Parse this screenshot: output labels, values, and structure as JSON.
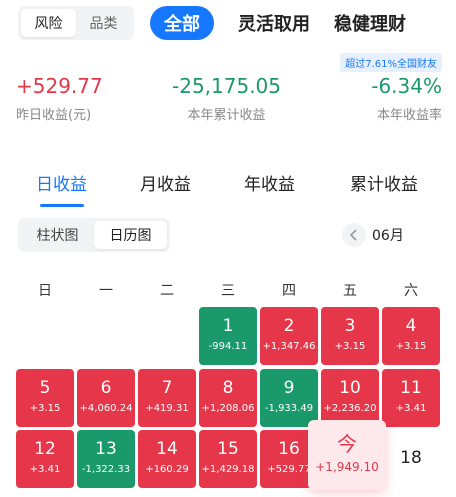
{
  "top_segment": {
    "items": [
      "风险",
      "品类"
    ],
    "active": 0
  },
  "top_nav": {
    "items": [
      "全部",
      "灵活取用",
      "稳健理财"
    ],
    "active": 0
  },
  "badge": "超过7.61%全国财友",
  "stats": [
    {
      "value": "+529.77",
      "label": "昨日收益(元)",
      "tone": "up"
    },
    {
      "value": "-25,175.05",
      "label": "本年累计收益",
      "tone": "down"
    },
    {
      "value": "-6.34%",
      "label": "本年收益率",
      "tone": "down"
    }
  ],
  "period_tabs": {
    "items": [
      "日收益",
      "月收益",
      "年收益",
      "累计收益"
    ],
    "active": 0
  },
  "view_toggle": {
    "items": [
      "柱状图",
      "日历图"
    ],
    "active": 1
  },
  "month": "06月",
  "weekdays": [
    "日",
    "一",
    "二",
    "三",
    "四",
    "五",
    "六"
  ],
  "calendar": {
    "days": [
      {
        "day": "1",
        "value": "-994.11",
        "tone": "down"
      },
      {
        "day": "2",
        "value": "+1,347.46",
        "tone": "up"
      },
      {
        "day": "3",
        "value": "+3.15",
        "tone": "up"
      },
      {
        "day": "4",
        "value": "+3.15",
        "tone": "up"
      },
      {
        "day": "5",
        "value": "+3.15",
        "tone": "up"
      },
      {
        "day": "6",
        "value": "+4,060.24",
        "tone": "up"
      },
      {
        "day": "7",
        "value": "+419.31",
        "tone": "up"
      },
      {
        "day": "8",
        "value": "+1,208.06",
        "tone": "up"
      },
      {
        "day": "9",
        "value": "-1,933.49",
        "tone": "down"
      },
      {
        "day": "10",
        "value": "+2,236.20",
        "tone": "up"
      },
      {
        "day": "11",
        "value": "+3.41",
        "tone": "up"
      },
      {
        "day": "12",
        "value": "+3.41",
        "tone": "up"
      },
      {
        "day": "13",
        "value": "-1,322.33",
        "tone": "down"
      },
      {
        "day": "14",
        "value": "+160.29",
        "tone": "up"
      },
      {
        "day": "15",
        "value": "+1,429.18",
        "tone": "up"
      },
      {
        "day": "16",
        "value": "+529.77",
        "tone": "up"
      }
    ],
    "today": {
      "label": "今",
      "value": "+1,949.10"
    },
    "after_today": "18"
  },
  "colors": {
    "accent": "#1677ff",
    "up": "#e5364a",
    "down": "#1a9a6a"
  }
}
